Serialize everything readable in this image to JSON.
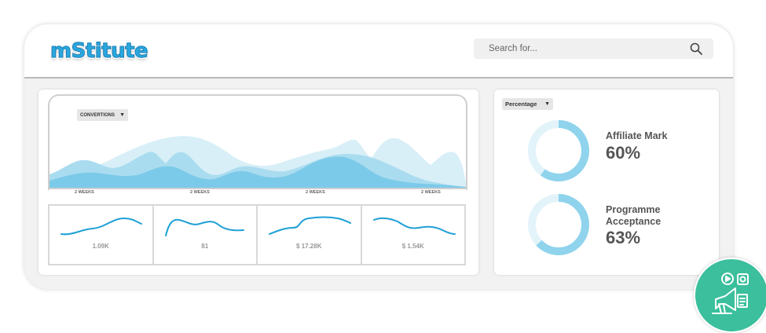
{
  "header": {
    "logo_text": "mStitute",
    "search_placeholder": "Search for..."
  },
  "main_chart": {
    "dropdown_label": "CONVERTIONS",
    "x_ticks": [
      "2 WEEKS",
      "2 WEEKS",
      "2 WEEKS",
      "2 WEEKS"
    ]
  },
  "stats": [
    {
      "value": "1.09K"
    },
    {
      "value": "81"
    },
    {
      "value": "$ 17.28K"
    },
    {
      "value": "$ 1.54K"
    }
  ],
  "side_panel": {
    "dropdown_label": "Percentage",
    "metrics": [
      {
        "label": "Affiliate Mark",
        "value": "60%",
        "percent": 60
      },
      {
        "label": "Programme Acceptance",
        "value": "63%",
        "percent": 63
      }
    ]
  },
  "colors": {
    "accent": "#2aa8df",
    "donut_fill": "#8fd3ec",
    "donut_track": "#e3f3fa",
    "badge": "#3bbf9d"
  },
  "icons": {
    "search": "search-icon",
    "caret": "caret-down-icon",
    "badge": "media-marketing-icon"
  }
}
